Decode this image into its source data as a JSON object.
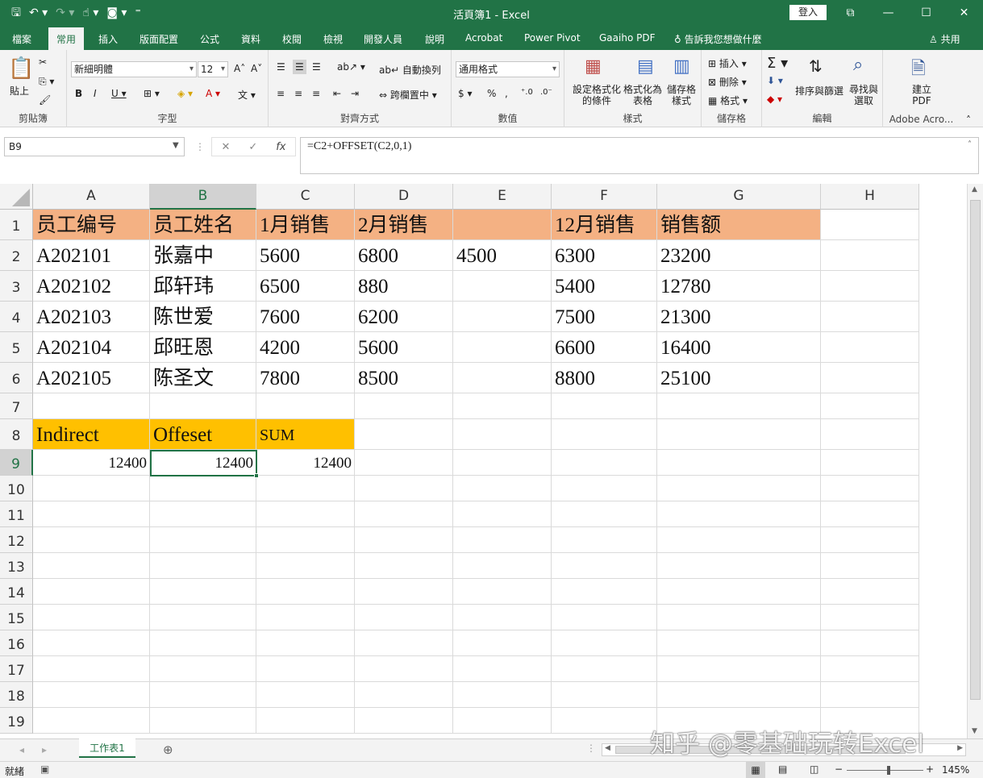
{
  "window": {
    "title": "活頁簿1 - Excel",
    "login": "登入"
  },
  "tabs": [
    "檔案",
    "常用",
    "插入",
    "版面配置",
    "公式",
    "資料",
    "校閱",
    "檢視",
    "開發人員",
    "說明",
    "Acrobat",
    "Power Pivot",
    "Gaaiho PDF"
  ],
  "tell_me": "告訴我您想做什麼",
  "share": "共用",
  "ribbon": {
    "clipboard": {
      "paste": "貼上",
      "label": "剪貼簿"
    },
    "font": {
      "name": "新細明體",
      "size": "12",
      "label": "字型"
    },
    "alignment": {
      "wrap": "自動換列",
      "merge": "跨欄置中",
      "label": "對齊方式"
    },
    "number": {
      "format": "通用格式",
      "label": "數值"
    },
    "styles": {
      "conditional": "設定格式化的條件",
      "table": "格式化為表格",
      "cell": "儲存格樣式",
      "label": "樣式"
    },
    "cells": {
      "insert": "插入",
      "delete": "刪除",
      "format": "格式",
      "label": "儲存格"
    },
    "editing": {
      "sort": "排序與篩選",
      "find": "尋找與選取",
      "label": "編輯"
    },
    "adobe": {
      "create": "建立 PDF",
      "label": "Adobe Acro..."
    }
  },
  "formula_bar": {
    "name_box": "B9",
    "formula": "=C2+OFFSET(C2,0,1)"
  },
  "columns": [
    "A",
    "B",
    "C",
    "D",
    "E",
    "F",
    "G",
    "H"
  ],
  "rows": [
    [
      "员工编号",
      "员工姓名",
      "1月销售",
      "2月销售",
      "",
      "12月销售",
      "销售额",
      ""
    ],
    [
      "A202101",
      "张嘉中",
      "5600",
      "6800",
      "4500",
      "6300",
      "23200",
      ""
    ],
    [
      "A202102",
      "邱轩玮",
      "6500",
      "880",
      "",
      "5400",
      "12780",
      ""
    ],
    [
      "A202103",
      "陈世爱",
      "7600",
      "6200",
      "",
      "7500",
      "21300",
      ""
    ],
    [
      "A202104",
      "邱旺恩",
      "4200",
      "5600",
      "",
      "6600",
      "16400",
      ""
    ],
    [
      "A202105",
      "陈圣文",
      "7800",
      "8500",
      "",
      "8800",
      "25100",
      ""
    ],
    [
      "",
      "",
      "",
      "",
      "",
      "",
      "",
      ""
    ],
    [
      "Indirect",
      "Offeset",
      "SUM",
      "",
      "",
      "",
      "",
      ""
    ],
    [
      "12400",
      "12400",
      "12400",
      "",
      "",
      "",
      "",
      ""
    ]
  ],
  "row_numbers": [
    "1",
    "2",
    "3",
    "4",
    "5",
    "6",
    "7",
    "8",
    "9",
    "10",
    "11",
    "12",
    "13",
    "14",
    "15",
    "16",
    "17",
    "18",
    "19"
  ],
  "sheet_tab": "工作表1",
  "status": {
    "ready": "就緒",
    "zoom": "145%"
  },
  "watermark": "知乎 @零基础玩转Excel"
}
